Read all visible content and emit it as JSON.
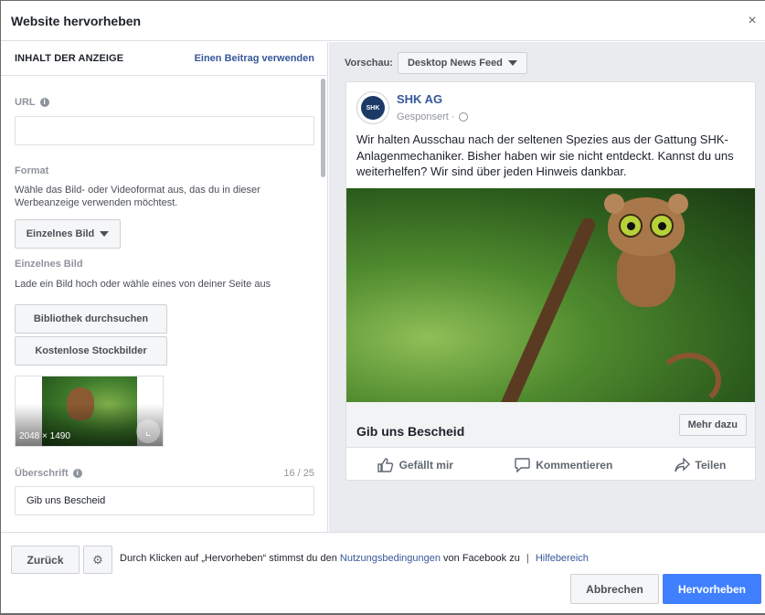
{
  "dialog": {
    "title": "Website hervorheben",
    "close_glyph": "×"
  },
  "left": {
    "header": "INHALT DER ANZEIGE",
    "use_post_link": "Einen Beitrag verwenden",
    "url_label": "URL",
    "url_value": "",
    "format_label": "Format",
    "format_desc": "Wähle das Bild- oder Videoformat aus, das du in dieser Werbeanzeige verwenden möchtest.",
    "format_select": "Einzelnes Bild",
    "single_image_label": "Einzelnes Bild",
    "single_image_desc": "Lade ein Bild hoch oder wähle eines von deiner Seite aus",
    "browse_library": "Bibliothek durchsuchen",
    "free_stock": "Kostenlose Stockbilder",
    "thumb_dimensions": "2048 × 1490",
    "headline_label": "Überschrift",
    "headline_counter": "16 / 25",
    "headline_value": "Gib uns Bescheid"
  },
  "preview": {
    "label": "Vorschau:",
    "placement": "Desktop News Feed",
    "page_name": "SHK AG",
    "avatar_text": "SHK",
    "sponsored": "Gesponsert ·",
    "post_text": "Wir halten Ausschau nach der seltenen Spezies aus der Gattung SHK-Anlagenmechaniker. Bisher haben wir sie nicht entdeckt. Kannst du uns weiterhelfen? Wir sind über jeden Hinweis dankbar.",
    "headline": "Gib uns Bescheid",
    "cta": "Mehr dazu",
    "actions": {
      "like": "Gefällt mir",
      "comment": "Kommentieren",
      "share": "Teilen"
    }
  },
  "footer": {
    "back": "Zurück",
    "terms_prefix": "Durch Klicken auf „Hervorheben“ stimmst du den",
    "terms_link": "Nutzungsbedingungen",
    "terms_suffix": "von Facebook zu",
    "separator": "|",
    "help_link": "Hilfebereich",
    "cancel": "Abbrechen",
    "submit": "Hervorheben"
  },
  "colors": {
    "link": "#365899",
    "primary": "#4080ff",
    "panel_bg": "#e9ebee"
  }
}
